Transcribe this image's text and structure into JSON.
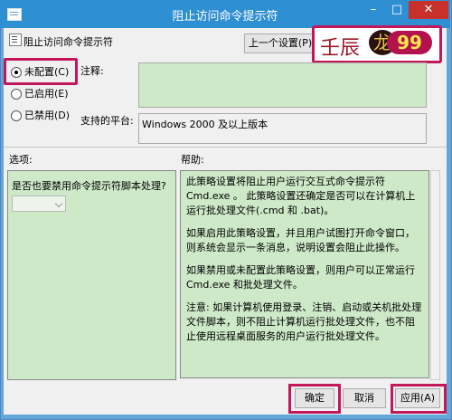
{
  "window": {
    "title": "阻止访问命令提示符"
  },
  "header": {
    "policy_name": "阻止访问命令提示符",
    "prev_button": "上一个设置(P)"
  },
  "watermark_badge": {
    "name": "壬辰",
    "seal": "龙",
    "number": "99"
  },
  "state": {
    "options": [
      {
        "label": "未配置(C)",
        "selected": true
      },
      {
        "label": "已启用(E)",
        "selected": false
      },
      {
        "label": "已禁用(D)",
        "selected": false
      }
    ]
  },
  "comment": {
    "label": "注释:",
    "value": ""
  },
  "platform": {
    "label": "支持的平台:",
    "value": "Windows 2000 及以上版本"
  },
  "options_section": {
    "label": "选项:",
    "question": "是否也要禁用命令提示符脚本处理?",
    "dropdown_value": ""
  },
  "help_section": {
    "label": "帮助:",
    "paragraphs": [
      "此策略设置将阻止用户运行交互式命令提示符 Cmd.exe 。 此策略设置还确定是否可以在计算机上运行批处理文件(.cmd 和 .bat)。",
      "如果启用此策略设置，并且用户试图打开命令窗口，则系统会显示一条消息，说明设置会阻止此操作。",
      "如果禁用或未配置此策略设置，则用户可以正常运行 Cmd.exe 和批处理文件。",
      "注意: 如果计算机使用登录、注销、启动或关机批处理文件脚本，则不阻止计算机运行批处理文件，也不阻止使用远程桌面服务的用户运行批处理文件。"
    ]
  },
  "buttons": {
    "ok": "确定",
    "cancel": "取消",
    "apply": "应用(A)"
  },
  "colors": {
    "accent": "#2f8fd3",
    "highlight": "#c2185b",
    "panel": "#cde9c8"
  }
}
